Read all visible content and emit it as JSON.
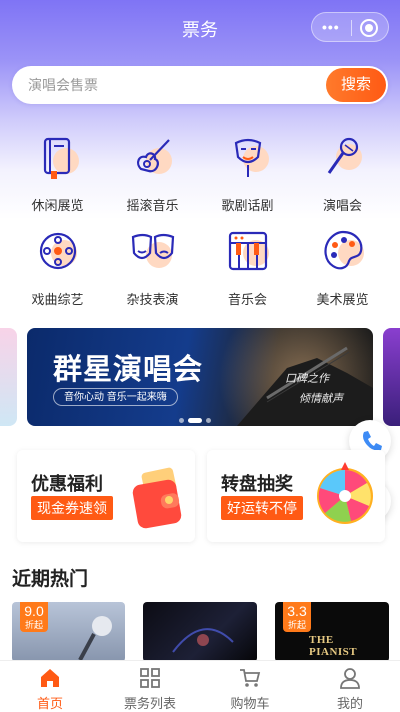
{
  "topbar": {
    "title": "票务"
  },
  "search": {
    "placeholder": "演唱会售票",
    "button": "搜索"
  },
  "categories": [
    {
      "label": "休闲展览",
      "icon": "book-icon"
    },
    {
      "label": "摇滚音乐",
      "icon": "guitar-icon"
    },
    {
      "label": "歌剧话剧",
      "icon": "theater-mask-icon"
    },
    {
      "label": "演唱会",
      "icon": "microphone-icon"
    },
    {
      "label": "戏曲综艺",
      "icon": "film-reel-icon"
    },
    {
      "label": "杂技表演",
      "icon": "drama-masks-icon"
    },
    {
      "label": "音乐会",
      "icon": "piano-icon"
    },
    {
      "label": "美术展览",
      "icon": "palette-icon"
    }
  ],
  "banner": {
    "title": "群星演唱会",
    "subtitle": "音你心动 音乐一起来嗨",
    "handwriting_1": "口碑之作",
    "handwriting_2": "倾情献声",
    "active_index": 1,
    "count": 3
  },
  "promos": [
    {
      "title": "优惠福利",
      "tag": "现金券速领",
      "image": "red-wallet-icon"
    },
    {
      "title": "转盘抽奖",
      "tag": "好运转不停",
      "image": "prize-wheel-icon"
    }
  ],
  "section": {
    "title": "近期热门"
  },
  "hot_cards": [
    {
      "price": "9.0",
      "suffix": "折起"
    },
    {
      "price": "",
      "suffix": ""
    },
    {
      "price": "3.3",
      "suffix": "折起",
      "poster_text": "THE PIANIST"
    }
  ],
  "tabbar": [
    {
      "label": "首页",
      "icon": "home-icon",
      "active": true
    },
    {
      "label": "票务列表",
      "icon": "grid-icon",
      "active": false
    },
    {
      "label": "购物车",
      "icon": "cart-icon",
      "active": false
    },
    {
      "label": "我的",
      "icon": "user-icon",
      "active": false
    }
  ],
  "colors": {
    "accent": "#ff5a14",
    "brand": "#7f74f5",
    "icon_stroke": "#2a2ab8"
  }
}
